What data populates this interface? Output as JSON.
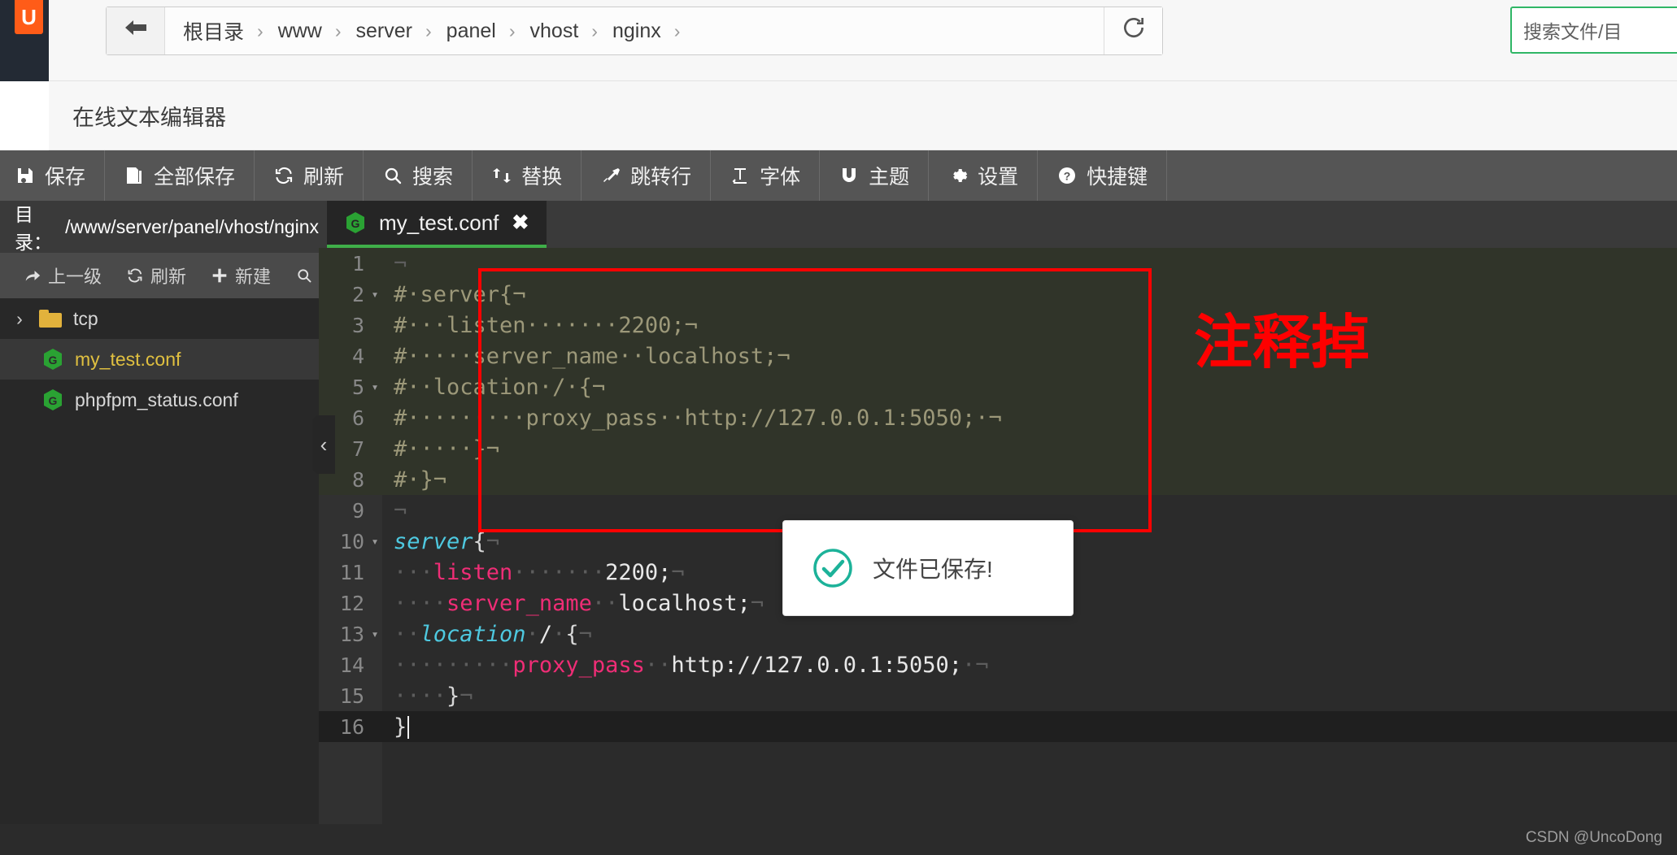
{
  "browser": {
    "back_icon": "arrow-left-icon",
    "refresh_icon": "refresh-icon",
    "breadcrumbs": [
      "根目录",
      "www",
      "server",
      "panel",
      "vhost",
      "nginx"
    ],
    "breadcrumb_separator": "›",
    "search_placeholder": "搜索文件/目"
  },
  "editor": {
    "title": "在线文本编辑器",
    "toolbar": [
      {
        "label": "保存",
        "icon": "save-icon"
      },
      {
        "label": "全部保存",
        "icon": "save-all-icon"
      },
      {
        "label": "刷新",
        "icon": "refresh-icon"
      },
      {
        "label": "搜索",
        "icon": "search-icon"
      },
      {
        "label": "替换",
        "icon": "replace-icon"
      },
      {
        "label": "跳转行",
        "icon": "goto-line-icon"
      },
      {
        "label": "字体",
        "icon": "font-icon"
      },
      {
        "label": "主题",
        "icon": "theme-magnet-icon"
      },
      {
        "label": "设置",
        "icon": "gear-icon"
      },
      {
        "label": "快捷键",
        "icon": "question-circle-icon"
      }
    ],
    "tab": {
      "name": "my_test.conf",
      "icon": "nginx-icon",
      "close": "✖"
    },
    "collapse_handle": "‹"
  },
  "sidebar": {
    "dir_label": "目录：",
    "dir_path": "/www/server/panel/vhost/nginx",
    "actions": [
      {
        "label": "上一级",
        "icon": "arrow-up-level-icon"
      },
      {
        "label": "刷新",
        "icon": "refresh-icon"
      },
      {
        "label": "新建",
        "icon": "plus-icon"
      },
      {
        "label": "搜索",
        "icon": "search-icon"
      }
    ],
    "files": [
      {
        "name": "tcp",
        "type": "folder",
        "selected": false,
        "chevron": "›"
      },
      {
        "name": "my_test.conf",
        "type": "nginx",
        "selected": true
      },
      {
        "name": "phpfpm_status.conf",
        "type": "nginx",
        "selected": false
      }
    ]
  },
  "code": {
    "lines": [
      {
        "n": "1",
        "state": "commented",
        "fold": "",
        "segs": [
          {
            "t": "¬",
            "c": "eol"
          }
        ]
      },
      {
        "n": "2",
        "state": "commented",
        "fold": "▾",
        "segs": [
          {
            "t": "#·server{¬",
            "c": "cm"
          }
        ]
      },
      {
        "n": "3",
        "state": "commented",
        "fold": "",
        "segs": [
          {
            "t": "#···listen·······2200;¬",
            "c": "cm"
          }
        ]
      },
      {
        "n": "4",
        "state": "commented",
        "fold": "",
        "segs": [
          {
            "t": "#·····server_name··localhost;¬",
            "c": "cm"
          }
        ]
      },
      {
        "n": "5",
        "state": "commented",
        "fold": "▾",
        "segs": [
          {
            "t": "#··location·/·{¬",
            "c": "cm"
          }
        ]
      },
      {
        "n": "6",
        "state": "commented",
        "fold": "",
        "segs": [
          {
            "t": "#·········proxy_pass··http://127.0.0.1:5050;·¬",
            "c": "cm"
          }
        ]
      },
      {
        "n": "7",
        "state": "commented",
        "fold": "",
        "segs": [
          {
            "t": "#·····}¬",
            "c": "cm"
          }
        ]
      },
      {
        "n": "8",
        "state": "commented",
        "fold": "",
        "segs": [
          {
            "t": "#·}¬",
            "c": "cm"
          }
        ]
      },
      {
        "n": "9",
        "state": "normal",
        "fold": "",
        "segs": [
          {
            "t": "¬",
            "c": "eol"
          }
        ]
      },
      {
        "n": "10",
        "state": "normal",
        "fold": "▾",
        "segs": [
          {
            "t": "server",
            "c": "kw-blue"
          },
          {
            "t": "{",
            "c": "brace"
          },
          {
            "t": "¬",
            "c": "eol"
          }
        ]
      },
      {
        "n": "11",
        "state": "normal",
        "fold": "",
        "segs": [
          {
            "t": "···",
            "c": "dot"
          },
          {
            "t": "listen",
            "c": "kw-pink"
          },
          {
            "t": "·······",
            "c": "dot"
          },
          {
            "t": "2200;",
            "c": "plain"
          },
          {
            "t": "¬",
            "c": "eol"
          }
        ]
      },
      {
        "n": "12",
        "state": "normal",
        "fold": "",
        "segs": [
          {
            "t": "····",
            "c": "dot"
          },
          {
            "t": "server_name",
            "c": "kw-pink"
          },
          {
            "t": "··",
            "c": "dot"
          },
          {
            "t": "localhost;",
            "c": "plain"
          },
          {
            "t": "¬",
            "c": "eol"
          }
        ]
      },
      {
        "n": "13",
        "state": "normal",
        "fold": "▾",
        "segs": [
          {
            "t": "··",
            "c": "dot"
          },
          {
            "t": "location",
            "c": "kw-blue"
          },
          {
            "t": "·",
            "c": "dot"
          },
          {
            "t": "/",
            "c": "plain"
          },
          {
            "t": "·",
            "c": "dot"
          },
          {
            "t": "{",
            "c": "brace"
          },
          {
            "t": "¬",
            "c": "eol"
          }
        ]
      },
      {
        "n": "14",
        "state": "normal",
        "fold": "",
        "segs": [
          {
            "t": "·········",
            "c": "dot"
          },
          {
            "t": "proxy_pass",
            "c": "kw-pink"
          },
          {
            "t": "··",
            "c": "dot"
          },
          {
            "t": "http://127.0.0.1:5050;",
            "c": "plain"
          },
          {
            "t": "·¬",
            "c": "eol"
          }
        ]
      },
      {
        "n": "15",
        "state": "normal",
        "fold": "",
        "segs": [
          {
            "t": "····",
            "c": "dot"
          },
          {
            "t": "}",
            "c": "brace"
          },
          {
            "t": "¬",
            "c": "eol"
          }
        ]
      },
      {
        "n": "16",
        "state": "active",
        "fold": "",
        "segs": [
          {
            "t": "}",
            "c": "brace"
          },
          {
            "t": "CARET",
            "c": "caret"
          }
        ]
      }
    ]
  },
  "annotation": {
    "text": "注释掉",
    "color": "#fe0000"
  },
  "toast": {
    "message": "文件已保存!",
    "icon": "check-circle-icon",
    "icon_color": "#1cb299"
  },
  "watermark": "CSDN @UncoDong",
  "colors": {
    "accent_green": "#3fae49",
    "toolbar_bg": "#555555",
    "editor_bg": "#2b2b2b",
    "sidebar_bg": "#282828",
    "selected_file": "#e0c040",
    "annotation_red": "#fe0000"
  }
}
